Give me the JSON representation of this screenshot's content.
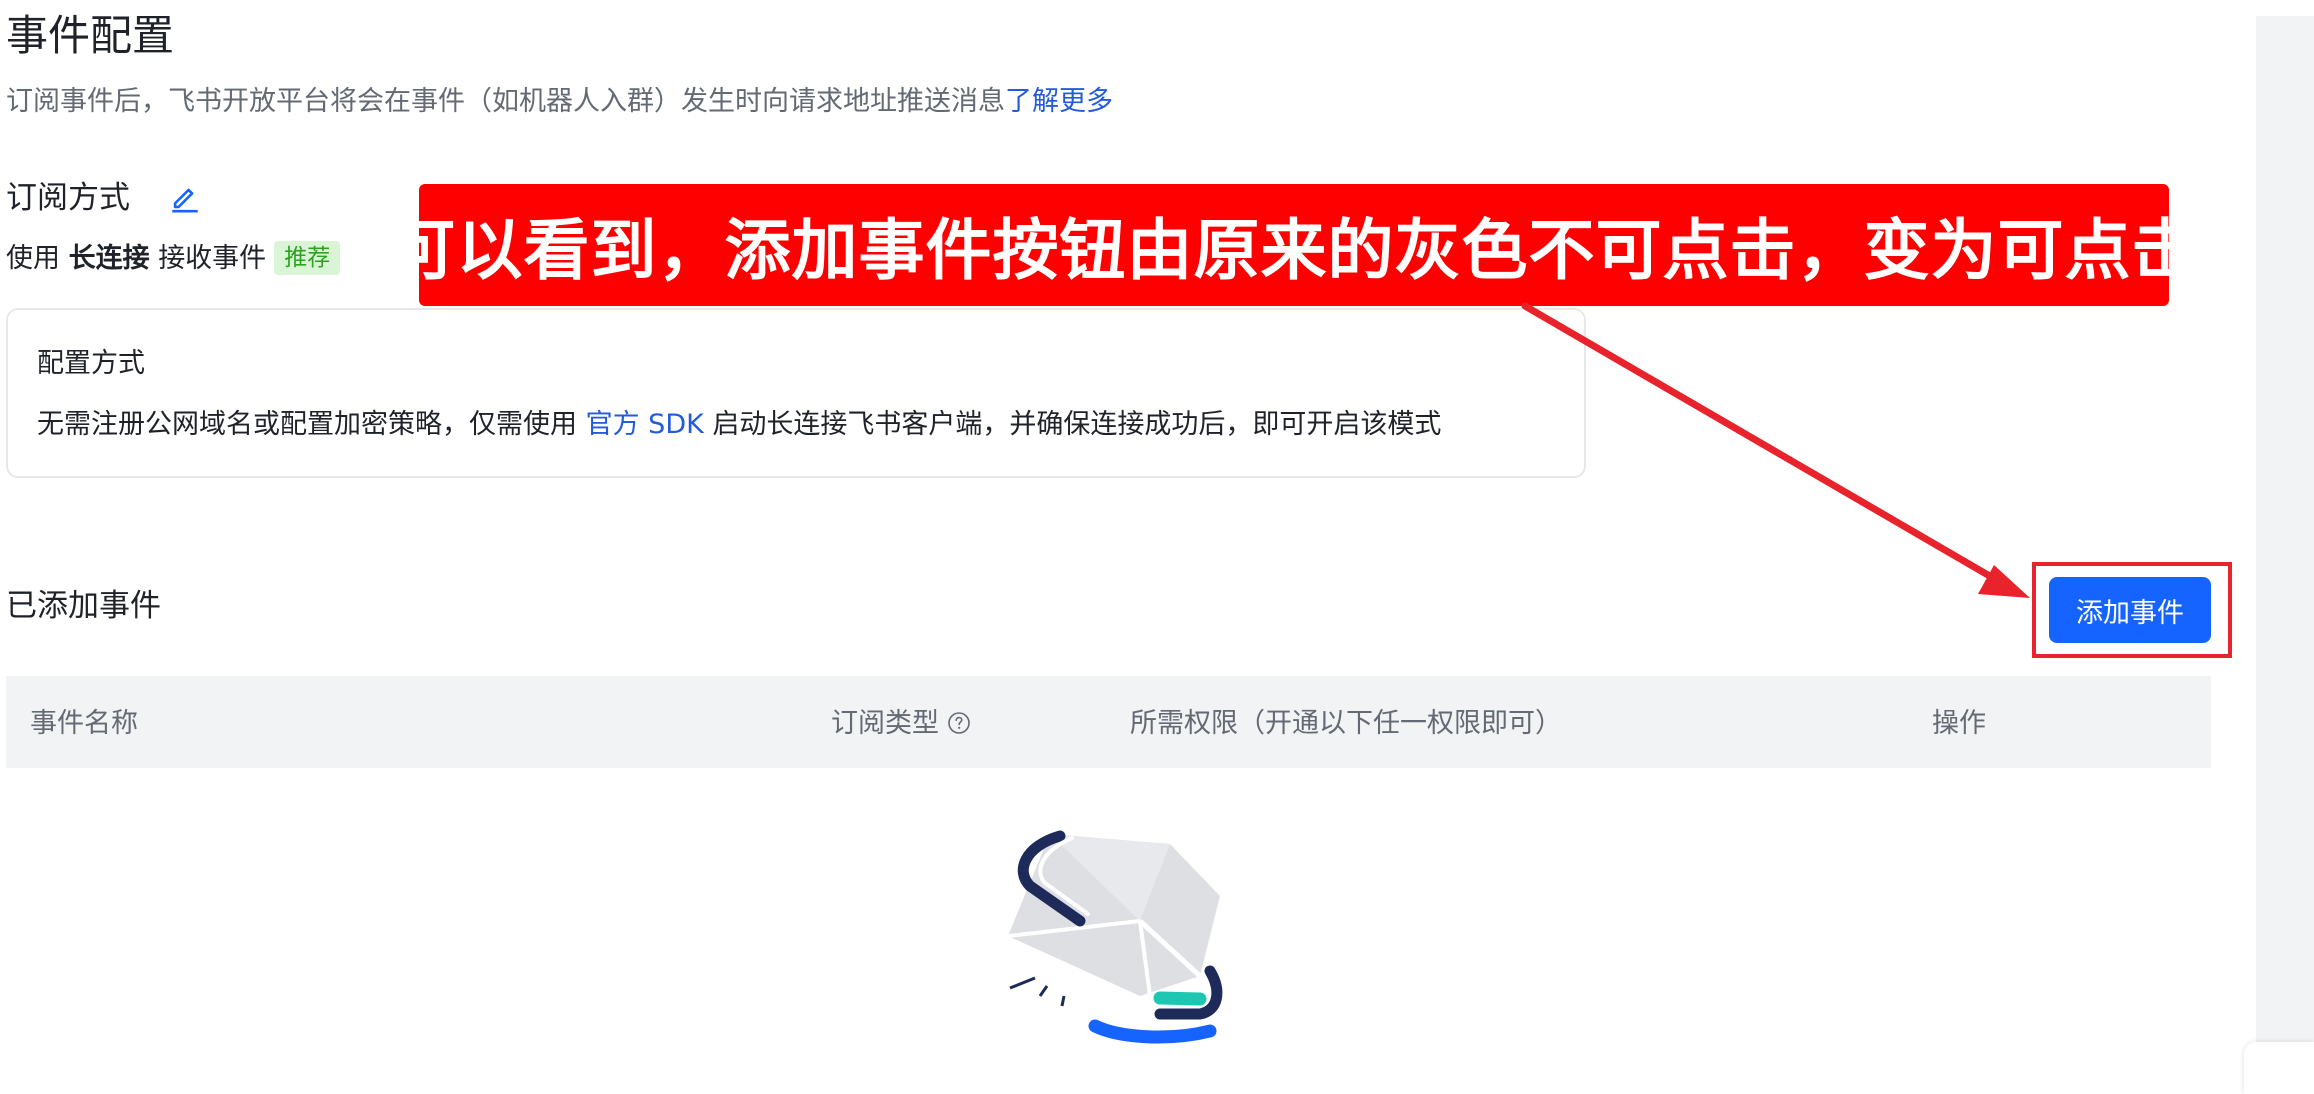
{
  "page": {
    "title": "事件配置",
    "description": "订阅事件后，飞书开放平台将会在事件（如机器人入群）发生时向请求地址推送消息",
    "learn_more": "了解更多"
  },
  "subscription": {
    "title": "订阅方式",
    "use_prefix": "使用",
    "mode": "长连接",
    "use_suffix": "接收事件",
    "tag": "推荐"
  },
  "config_card": {
    "title": "配置方式",
    "desc_before": "无需注册公网域名或配置加密策略，仅需使用",
    "sdk_link": "官方 SDK",
    "desc_after": "启动长连接飞书客户端，并确保连接成功后，即可开启该模式"
  },
  "events": {
    "title": "已添加事件",
    "add_button": "添加事件",
    "columns": [
      "事件名称",
      "订阅类型",
      "所需权限（开通以下任一权限即可）",
      "操作"
    ]
  },
  "annotation": {
    "text": "可以看到，添加事件按钮由原来的灰色不可点击，变为可点击"
  },
  "colors": {
    "primary": "#1664ff",
    "link": "#245bdb",
    "annotation_red": "#ff0000",
    "tag_green": "#2ea121"
  },
  "icons": [
    "edit-icon",
    "help-circle-icon",
    "empty-box-icon"
  ]
}
